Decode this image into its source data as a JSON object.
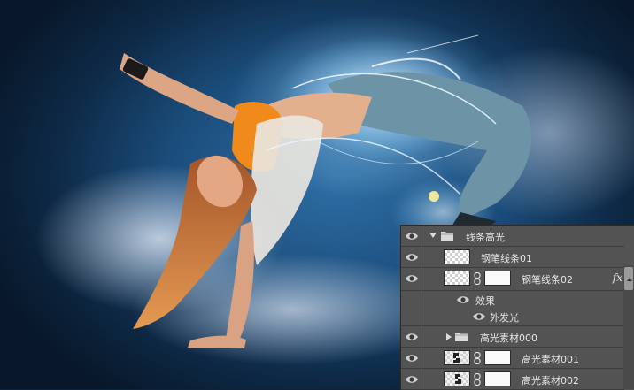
{
  "canvas": {
    "description_icon": "photo-canvas"
  },
  "layers": {
    "rows": [
      {
        "type": "group",
        "label": "线条高光",
        "expanded": true
      },
      {
        "type": "layer",
        "label": "钢笔线条01"
      },
      {
        "type": "layer",
        "label": "钢笔线条02",
        "fx": "fx"
      },
      {
        "type": "effects",
        "label": "效果"
      },
      {
        "type": "effect",
        "label": "外发光"
      },
      {
        "type": "group",
        "label": "高光素材000",
        "expanded": false
      },
      {
        "type": "layer",
        "label": "高光素材001"
      },
      {
        "type": "layer",
        "label": "高光素材002"
      }
    ]
  },
  "colors": {
    "panel_bg": "#535353",
    "row_border": "#3c3c3c",
    "text": "#e6e6e6"
  }
}
